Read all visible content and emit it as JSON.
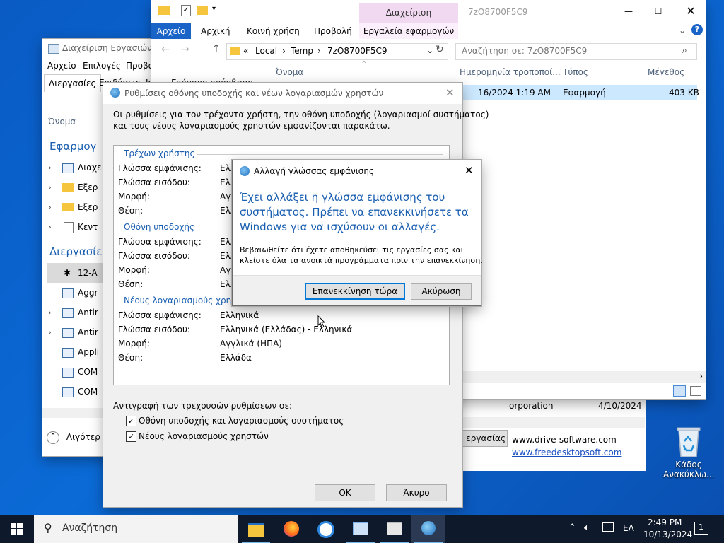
{
  "desktop": {
    "recycle_bin_line1": "Κάδος",
    "recycle_bin_line2": "Ανακύκλω..."
  },
  "taskmgr": {
    "title": "Διαχείριση Εργασιών",
    "menu": [
      "Αρχείο",
      "Επιλογές",
      "Προβολ"
    ],
    "tabs": [
      "Διεργασίες",
      "Επιδόσεις",
      "Ιστ"
    ],
    "col_name": "Όνομα",
    "sec_apps": "Εφαρμογ",
    "apps": [
      "Διαχε",
      "Εξερ",
      "Εξερ",
      "Κεντ"
    ],
    "sec_bg": "Διεργασίε",
    "bg": [
      "12-A",
      "Aggr",
      "Antir",
      "Antir",
      "Appli",
      "COM",
      "COM"
    ],
    "fewer_details": "Λιγότερ",
    "end_task_fragment": "εργασίας",
    "corp_fragment": "orporation",
    "date_fragment": "4/10/2024",
    "link1": "www.drive-software.com",
    "link2": "www.freedesktopsoft.com"
  },
  "explorer": {
    "manage_tab": "Διαχείριση",
    "window_title": "7zO8700F5C9",
    "tabs": [
      "Αρχείο",
      "Αρχική",
      "Κοινή χρήση",
      "Προβολή",
      "Εργαλεία εφαρμογών"
    ],
    "breadcrumb": [
      "Local",
      "Temp",
      "7zO8700F5C9"
    ],
    "search_placeholder": "Αναζήτηση σε: 7zO8700F5C9",
    "columns": {
      "name": "Όνομα",
      "date": "Ημερομηνία τροποποί...",
      "type": "Τύπος",
      "size": "Μέγεθος"
    },
    "row": {
      "date": "16/2024 1:19 AM",
      "type": "Εφαρμογή",
      "size": "403 KB"
    },
    "quick_access_fragment": "Γρήγορη πρόσβαση"
  },
  "settings": {
    "title": "Ρυθμίσεις οθόνης υποδοχής και νέων λογαριασμών χρηστών",
    "intro1": "Οι ρυθμίσεις για τον τρέχοντα χρήστη, την οθόνη υποδοχής (λογαριασμοί συστήματος)",
    "intro2": "και τους νέους λογαριασμούς χρηστών εμφανίζονται παρακάτω.",
    "g1_label": "Τρέχων χρήστης",
    "g2_label": "Οθόνη υποδοχής",
    "g3_label": "Νέους λογαριασμούς χρηστών",
    "lbl_display": "Γλώσσα εμφάνισης:",
    "lbl_input": "Γλώσσα εισόδου:",
    "lbl_format": "Μορφή:",
    "lbl_location": "Θέση:",
    "g1_vals": [
      "Ελλ",
      "Ελλ",
      "Αγγ",
      "Ελλ"
    ],
    "g2_vals": [
      "Ελλ",
      "Ελλ",
      "Αγγ",
      "Ελλ"
    ],
    "g3_vals": [
      "Ελληνικά",
      "Ελληνικά (Ελλάδας) - Ελληνικά",
      "Αγγλικά (ΗΠΑ)",
      "Ελλάδα"
    ],
    "copy_label": "Αντιγραφή των τρεχουσών ρυθμίσεων σε:",
    "cb1": "Οθόνη υποδοχής και λογαριασμούς συστήματος",
    "cb2": "Νέους λογαριασμούς χρηστών",
    "ok": "OK",
    "cancel": "Άκυρο"
  },
  "alert": {
    "title": "Αλλαγή γλώσσας εμφάνισης",
    "main1": "Έχει αλλάξει η γλώσσα εμφάνισης του",
    "main2": "συστήματος. Πρέπει να επανεκκινήσετε τα",
    "main3": "Windows για να ισχύσουν οι αλλαγές.",
    "sub1": "Βεβαιωθείτε ότι έχετε αποθηκεύσει τις εργασίες σας και",
    "sub2": "κλείστε όλα τα ανοικτά προγράμματα πριν την επανεκκίνηση.",
    "restart": "Επανεκκίνηση τώρα",
    "cancel": "Ακύρωση"
  },
  "taskbar": {
    "search_placeholder": "Αναζήτηση",
    "lang": "ΕΛ",
    "time": "2:49 PM",
    "date": "10/13/2024",
    "notif_count": "1"
  },
  "colors": {
    "accent": "#1a64c8",
    "heading": "#1b5fb0",
    "taskbar": "#0e1a2b",
    "ribbon_manage": "#f2d9f2"
  }
}
